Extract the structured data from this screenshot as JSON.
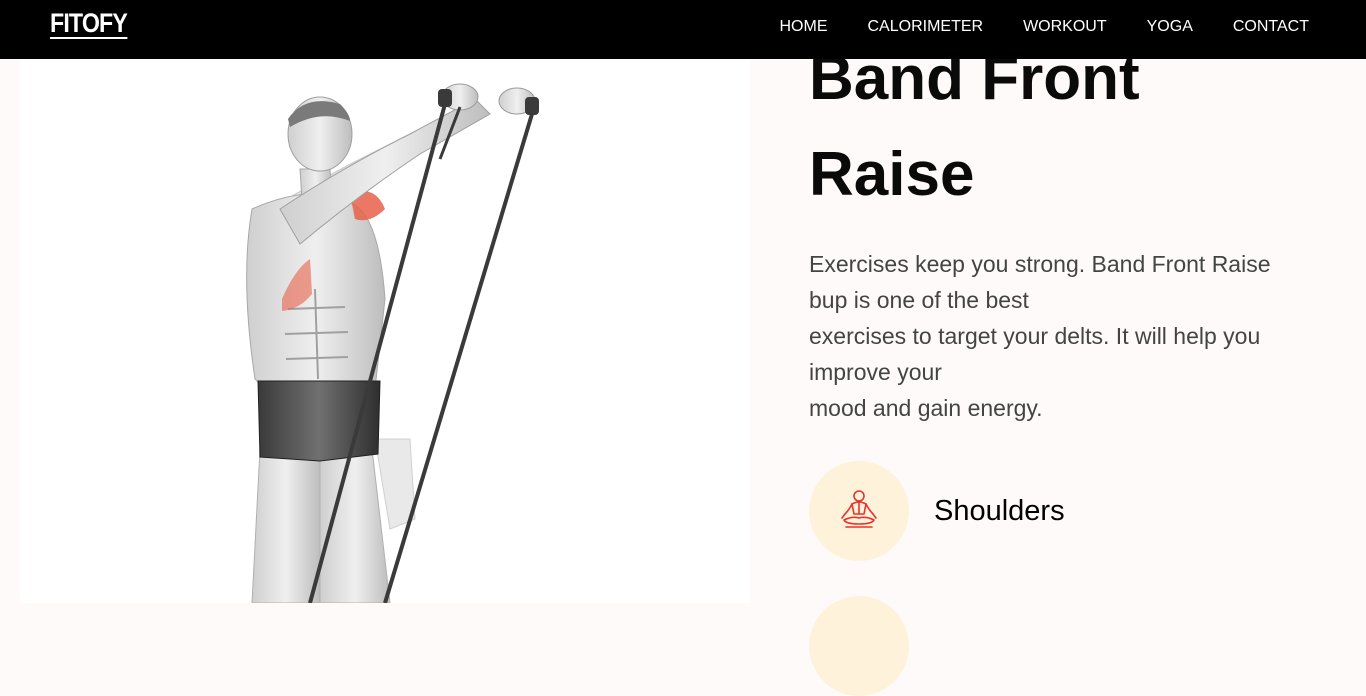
{
  "nav": {
    "logo": "FITOFY",
    "links": [
      "HOME",
      "CALORIMETER",
      "WORKOUT",
      "YOGA",
      "CONTACT"
    ]
  },
  "exercise": {
    "title_line1": "Band Front",
    "title_line2": "Raise",
    "description": [
      "Exercises keep you strong. Band Front Raise",
      "bup is one of the best",
      "exercises to target your delts. It will help you",
      "improve your",
      "mood and gain energy."
    ],
    "target_muscle": {
      "icon": "meditation-icon",
      "label": "Shoulders"
    }
  },
  "colors": {
    "navbar": "#000000",
    "muscle_circle": "#fef3da",
    "icon_accent": "#e8322c",
    "highlight_muscle": "#e8604a"
  }
}
